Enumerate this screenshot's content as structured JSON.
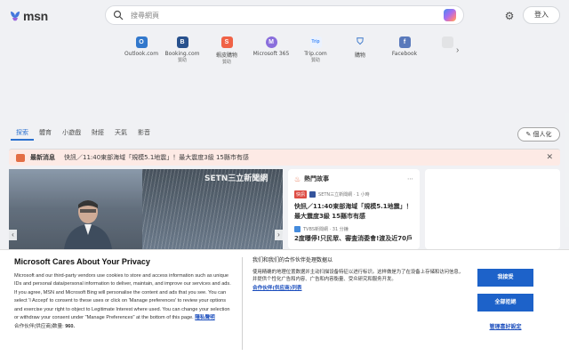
{
  "header": {
    "logo_text": "msn",
    "search_placeholder": "搜尋網頁",
    "signin_label": "登入"
  },
  "quick_links": [
    {
      "label": "Outlook.com",
      "sub": "",
      "color": "#1666c5",
      "glyph": "O"
    },
    {
      "label": "Booking.com",
      "sub": "贊助",
      "color": "#0b3a7e",
      "glyph": "B"
    },
    {
      "label": "蝦皮購物",
      "sub": "贊助",
      "color": "#ee4d2d",
      "glyph": "S"
    },
    {
      "label": "Microsoft 365",
      "sub": "",
      "color": "#7a5bd8",
      "glyph": "M"
    },
    {
      "label": "Trip.com",
      "sub": "贊助",
      "color": "#287dfa",
      "glyph": "T"
    },
    {
      "label": "購物",
      "sub": "",
      "color": "#2065c4",
      "glyph": "🛍"
    },
    {
      "label": "Facebook",
      "sub": "",
      "color": "#1877f2",
      "glyph": "f"
    },
    {
      "label": "",
      "sub": "",
      "color": "#c8c8c8",
      "glyph": ""
    }
  ],
  "nav": {
    "items": [
      "探索",
      "體育",
      "小遊戲",
      "財經",
      "天氣",
      "影音"
    ],
    "personalize_label": "個人化"
  },
  "breaking": {
    "tag": "最新消息",
    "text": "快訊／11:40東部海域「規模5.1地震」！最大震度3級 15縣市有感"
  },
  "hero": {
    "watermark": "SETN三立新聞網"
  },
  "hot_news": {
    "title": "熱門故事",
    "story1": {
      "tag": "快訊",
      "source": "SETN三立新聞網 · 1 小時",
      "title": "快訊／11:40東部海域「規模5.1地震」！最大震度3級 15縣市有感"
    },
    "story2": {
      "source": "TVBS新聞網 · 31 分鐘",
      "title": "2度曝停!只民眾、審査消委會!渡及近70戶"
    }
  },
  "consent": {
    "title": "Microsoft Cares About Your Privacy",
    "body": "Microsoft and our third-party vendors use cookies to store and access information such as unique IDs and personal data/personal information to deliver, maintain, and improve our services and ads. If you agree, MSN and Microsoft Bing will personalise the content and ads that you see. You can select 'I Accept' to consent to these uses or click on 'Manage preferences' to review your options and exercise your right to object to Legitimate Interest where used. You can change your selection or withdraw your consent under \"Manage Preferences\" at the bottom of this page.",
    "privacy_link": "隱私聲明",
    "partners_label": "合作伙伴(供应商)数量:",
    "partners_count": "960.",
    "mid_title": "我们和我们的合作伙伴处理数据以",
    "mid_body": "使用精确的地理位置数据并主动扫描设备特征以进行标识。这样做是为了在设备上存储和访问信息，并提供个性化广告和内容、广告和内容衡量、受众研究和服务开发。",
    "mid_link": "合作伙伴(供应商)列表",
    "accept_label": "我接受",
    "reject_label": "全部拒絕",
    "manage_label": "管理喜好設定"
  }
}
